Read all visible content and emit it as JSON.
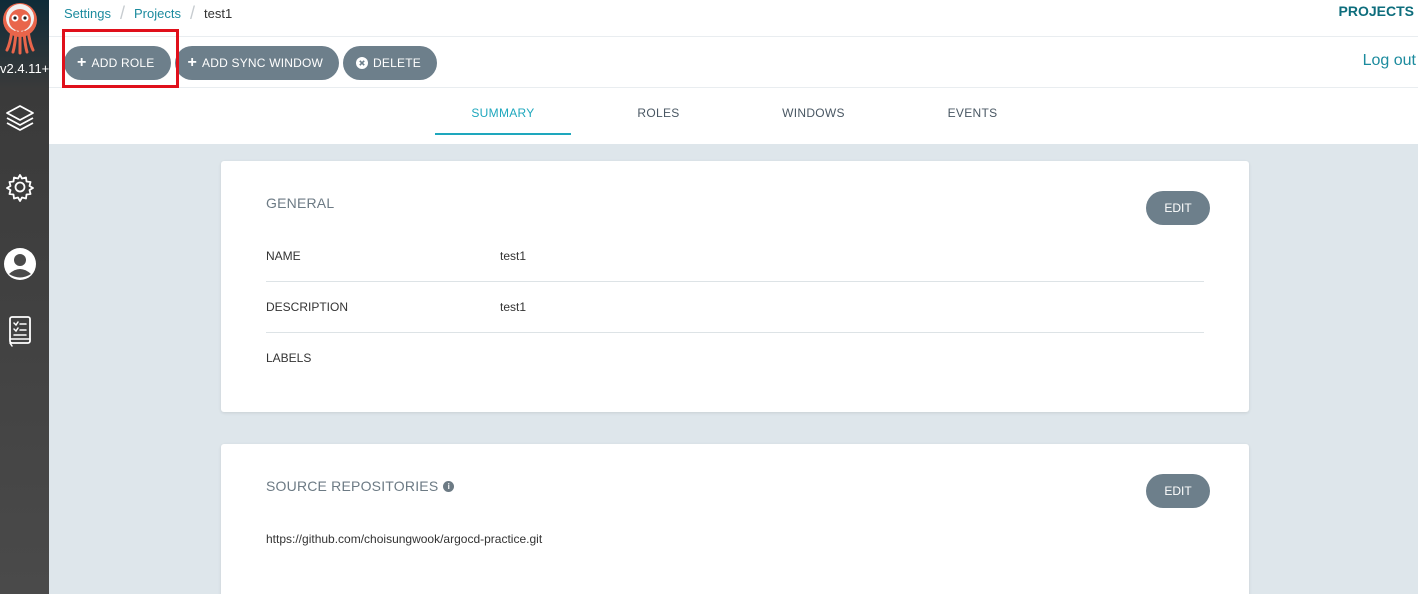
{
  "app": {
    "version": "v2.4.11+"
  },
  "sidebar": {
    "items": [
      {
        "name": "applications",
        "icon": "layers-icon"
      },
      {
        "name": "settings",
        "icon": "gear-icon"
      },
      {
        "name": "user-info",
        "icon": "user-circle-icon"
      },
      {
        "name": "documentation",
        "icon": "book-icon"
      }
    ]
  },
  "breadcrumb": {
    "items": [
      "Settings",
      "Projects"
    ],
    "current": "test1"
  },
  "header": {
    "section": "PROJECTS",
    "logout_label": "Log out"
  },
  "toolbar": {
    "add_role_label": "ADD ROLE",
    "add_sync_window_label": "ADD SYNC WINDOW",
    "delete_label": "DELETE"
  },
  "tabs": [
    {
      "label": "SUMMARY",
      "active": true
    },
    {
      "label": "ROLES",
      "active": false
    },
    {
      "label": "WINDOWS",
      "active": false
    },
    {
      "label": "EVENTS",
      "active": false
    }
  ],
  "general": {
    "title": "GENERAL",
    "edit_label": "EDIT",
    "fields": [
      {
        "key": "NAME",
        "value": "test1"
      },
      {
        "key": "DESCRIPTION",
        "value": "test1"
      },
      {
        "key": "LABELS",
        "value": ""
      }
    ]
  },
  "source_repositories": {
    "title": "SOURCE REPOSITORIES",
    "edit_label": "EDIT",
    "items": [
      "https://github.com/choisungwook/argocd-practice.git"
    ]
  },
  "colors": {
    "accent": "#1ea7bd",
    "link": "#1c8b9e",
    "button": "#6d7f8b",
    "highlight": "#e0101b",
    "background": "#dee6eb"
  }
}
